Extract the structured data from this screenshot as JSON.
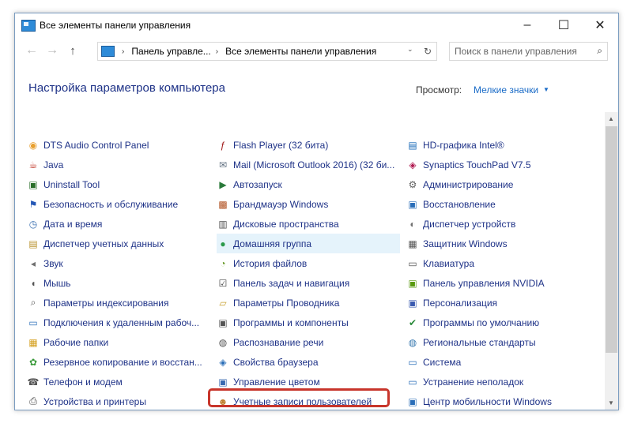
{
  "window": {
    "title": "Все элементы панели управления",
    "minimize": "–",
    "maximize": "☐",
    "close": "✕"
  },
  "nav": {
    "back": "←",
    "forward": "→",
    "up": "↑",
    "breadcrumb1": "Панель управле...",
    "breadcrumb2": "Все элементы панели управления",
    "sep": "›",
    "dropdown": "⌄",
    "refresh": "↻"
  },
  "search": {
    "placeholder": "Поиск в панели управления",
    "icon": "⌕"
  },
  "header": {
    "title": "Настройка параметров компьютера",
    "view_label": "Просмотр:",
    "view_value": "Мелкие значки",
    "view_arrow": "▼"
  },
  "columns": [
    [
      {
        "label": "DTS Audio Control Panel",
        "icon": "dts-icon",
        "glyph": "◉",
        "color": "#e8a030"
      },
      {
        "label": "Java",
        "icon": "java-icon",
        "glyph": "☕",
        "color": "#c0392b"
      },
      {
        "label": "Uninstall Tool",
        "icon": "uninstall-icon",
        "glyph": "▣",
        "color": "#2a6e2a"
      },
      {
        "label": "Безопасность и обслуживание",
        "icon": "flag-icon",
        "glyph": "⚑",
        "color": "#2457b5"
      },
      {
        "label": "Дата и время",
        "icon": "clock-icon",
        "glyph": "◷",
        "color": "#3a6fb0"
      },
      {
        "label": "Диспетчер учетных данных",
        "icon": "credential-icon",
        "glyph": "▤",
        "color": "#b8922e"
      },
      {
        "label": "Звук",
        "icon": "speaker-icon",
        "glyph": "◂",
        "color": "#707070"
      },
      {
        "label": "Мышь",
        "icon": "mouse-icon",
        "glyph": "◖",
        "color": "#555"
      },
      {
        "label": "Параметры индексирования",
        "icon": "index-icon",
        "glyph": "⌕",
        "color": "#555"
      },
      {
        "label": "Подключения к удаленным рабоч...",
        "icon": "remote-icon",
        "glyph": "▭",
        "color": "#2a6eb8"
      },
      {
        "label": "Рабочие папки",
        "icon": "folder-icon",
        "glyph": "▦",
        "color": "#d4a020"
      },
      {
        "label": "Резервное копирование и восстан...",
        "icon": "backup-icon",
        "glyph": "✿",
        "color": "#3a9a3a"
      },
      {
        "label": "Телефон и модем",
        "icon": "phone-icon",
        "glyph": "☎",
        "color": "#555"
      },
      {
        "label": "Устройства и принтеры",
        "icon": "printer-icon",
        "glyph": "⎙",
        "color": "#444"
      }
    ],
    [
      {
        "label": "Flash Player (32 бита)",
        "icon": "flash-icon",
        "glyph": "ƒ",
        "color": "#a01a1a"
      },
      {
        "label": "Mail (Microsoft Outlook 2016) (32 би...",
        "icon": "mail-icon",
        "glyph": "✉",
        "color": "#607080"
      },
      {
        "label": "Автозапуск",
        "icon": "autorun-icon",
        "glyph": "▶",
        "color": "#2a7a3a"
      },
      {
        "label": "Брандмауэр Windows",
        "icon": "firewall-icon",
        "glyph": "▩",
        "color": "#b05020"
      },
      {
        "label": "Дисковые пространства",
        "icon": "storage-icon",
        "glyph": "▥",
        "color": "#555"
      },
      {
        "label": "Домашняя группа",
        "icon": "homegroup-icon",
        "glyph": "●",
        "color": "#2a9a4a"
      },
      {
        "label": "История файлов",
        "icon": "history-icon",
        "glyph": "◔",
        "color": "#6a9a2a"
      },
      {
        "label": "Панель задач и навигация",
        "icon": "taskbar-icon",
        "glyph": "☑",
        "color": "#444"
      },
      {
        "label": "Параметры Проводника",
        "icon": "explorer-options-icon",
        "glyph": "▱",
        "color": "#c8a030"
      },
      {
        "label": "Программы и компоненты",
        "icon": "programs-icon",
        "glyph": "▣",
        "color": "#555"
      },
      {
        "label": "Распознавание речи",
        "icon": "speech-icon",
        "glyph": "◍",
        "color": "#555"
      },
      {
        "label": "Свойства браузера",
        "icon": "browser-icon",
        "glyph": "◈",
        "color": "#2a6eb8"
      },
      {
        "label": "Управление цветом",
        "icon": "color-icon",
        "glyph": "▣",
        "color": "#3a6ab0"
      },
      {
        "label": "Учетные записи пользователей",
        "icon": "users-icon",
        "glyph": "☻",
        "color": "#c08030"
      }
    ],
    [
      {
        "label": "HD-графика Intel®",
        "icon": "intel-icon",
        "glyph": "▤",
        "color": "#1a6ab8"
      },
      {
        "label": "Synaptics TouchPad V7.5",
        "icon": "touchpad-icon",
        "glyph": "◈",
        "color": "#b01a50"
      },
      {
        "label": "Администрирование",
        "icon": "admin-icon",
        "glyph": "⚙",
        "color": "#606060"
      },
      {
        "label": "Восстановление",
        "icon": "recovery-icon",
        "glyph": "▣",
        "color": "#2a6eb8"
      },
      {
        "label": "Диспетчер устройств",
        "icon": "devmgr-icon",
        "glyph": "◐",
        "color": "#707070"
      },
      {
        "label": "Защитник Windows",
        "icon": "defender-icon",
        "glyph": "▦",
        "color": "#555"
      },
      {
        "label": "Клавиатура",
        "icon": "keyboard-icon",
        "glyph": "▭",
        "color": "#555"
      },
      {
        "label": "Панель управления NVIDIA",
        "icon": "nvidia-icon",
        "glyph": "▣",
        "color": "#5a9a10"
      },
      {
        "label": "Персонализация",
        "icon": "personalize-icon",
        "glyph": "▣",
        "color": "#3a5ab0"
      },
      {
        "label": "Программы по умолчанию",
        "icon": "default-programs-icon",
        "glyph": "✔",
        "color": "#2a8a3a"
      },
      {
        "label": "Региональные стандарты",
        "icon": "region-icon",
        "glyph": "◍",
        "color": "#3a7ab0"
      },
      {
        "label": "Система",
        "icon": "system-icon",
        "glyph": "▭",
        "color": "#2a6eb8"
      },
      {
        "label": "Устранение неполадок",
        "icon": "troubleshoot-icon",
        "glyph": "▭",
        "color": "#2a6eb8"
      },
      {
        "label": "Центр мобильности Windows",
        "icon": "mobility-icon",
        "glyph": "▣",
        "color": "#2a6eb8"
      }
    ]
  ]
}
